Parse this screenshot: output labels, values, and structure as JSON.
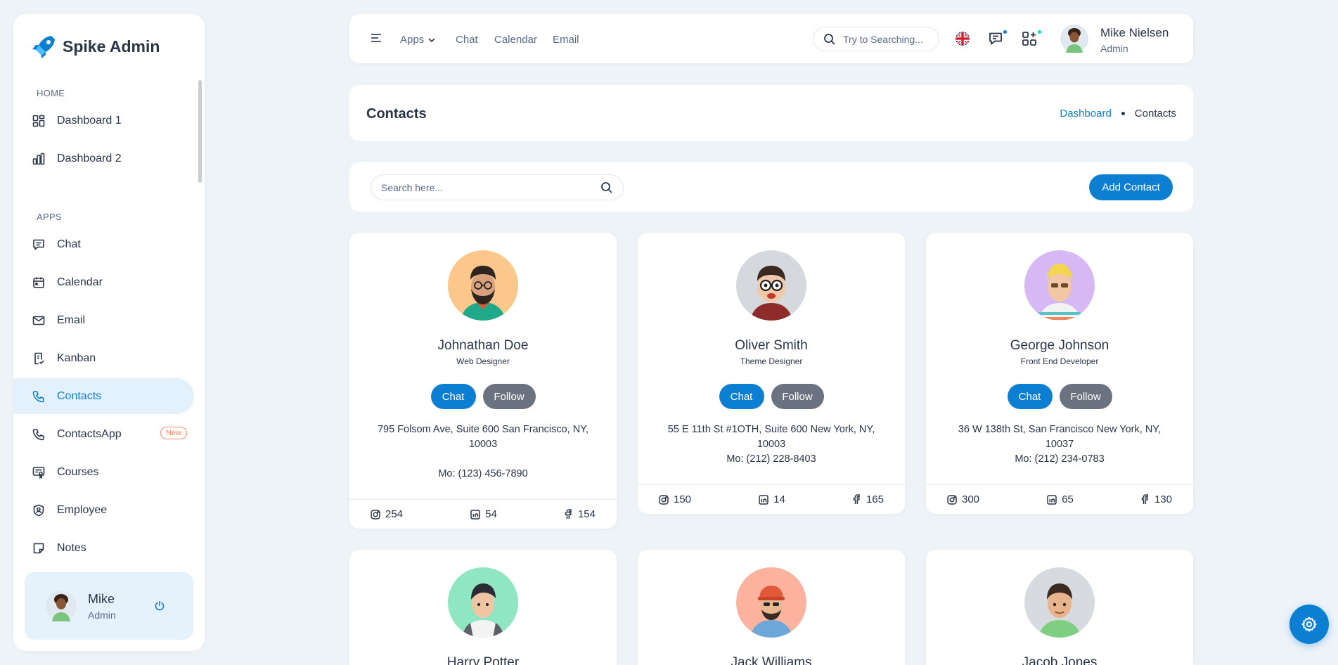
{
  "app": {
    "brand": "Spike Admin"
  },
  "sidebar": {
    "sections": [
      {
        "caption": "HOME",
        "items": [
          {
            "label": "Dashboard 1",
            "icon": "dashboard-grid-icon"
          },
          {
            "label": "Dashboard 2",
            "icon": "bar-chart-icon"
          }
        ]
      },
      {
        "caption": "APPS",
        "items": [
          {
            "label": "Chat",
            "icon": "chat-icon"
          },
          {
            "label": "Calendar",
            "icon": "calendar-icon"
          },
          {
            "label": "Email",
            "icon": "mail-icon"
          },
          {
            "label": "Kanban",
            "icon": "kanban-icon"
          },
          {
            "label": "Contacts",
            "icon": "phone-icon",
            "active": true
          },
          {
            "label": "ContactsApp",
            "icon": "phone-icon",
            "badge": "New"
          },
          {
            "label": "Courses",
            "icon": "certificate-icon"
          },
          {
            "label": "Employee",
            "icon": "shield-icon"
          },
          {
            "label": "Notes",
            "icon": "note-icon"
          }
        ]
      }
    ],
    "user": {
      "name": "Mike",
      "role": "Admin"
    }
  },
  "topbar": {
    "links": [
      "Apps",
      "Chat",
      "Calendar",
      "Email"
    ],
    "search_placeholder": "Try to Searching...",
    "profile": {
      "name": "Mike Nielsen",
      "role": "Admin"
    }
  },
  "page": {
    "title": "Contacts",
    "breadcrumb": {
      "home": "Dashboard",
      "current": "Contacts"
    }
  },
  "toolbar": {
    "search_placeholder": "Search here...",
    "add_label": "Add Contact"
  },
  "contacts": [
    {
      "name": "Johnathan Doe",
      "role": "Web Designer",
      "address": "795 Folsom Ave, Suite 600 San Francisco, NY, 10003",
      "phone": "Mo: (123) 456-7890",
      "instagram": "254",
      "linkedin": "54",
      "facebook": "154",
      "chat_label": "Chat",
      "follow_label": "Follow",
      "avatar_bg": "#fbc78a"
    },
    {
      "name": "Oliver Smith",
      "role": "Theme Designer",
      "address": "55 E 11th St #1OTH, Suite 600 New York, NY, 10003",
      "phone": "Mo: (212) 228-8403",
      "instagram": "150",
      "linkedin": "14",
      "facebook": "165",
      "chat_label": "Chat",
      "follow_label": "Follow",
      "avatar_bg": "#d5d9de"
    },
    {
      "name": "George Johnson",
      "role": "Front End Developer",
      "address": "36 W 138th St, San Francisco New York, NY, 10037",
      "phone": "Mo: (212) 234-0783",
      "instagram": "300",
      "linkedin": "65",
      "facebook": "130",
      "chat_label": "Chat",
      "follow_label": "Follow",
      "avatar_bg": "#d6b8f5"
    },
    {
      "name": "Harry Potter",
      "avatar_bg": "#8fe6c2"
    },
    {
      "name": "Jack Williams",
      "avatar_bg": "#fbb3a0"
    },
    {
      "name": "Jacob Jones",
      "avatar_bg": "#d7dbe0"
    }
  ],
  "colors": {
    "primary": "#0d7fd2",
    "follow": "#6b7280",
    "badge_new": "#fa896b",
    "background": "#eef3f8"
  }
}
